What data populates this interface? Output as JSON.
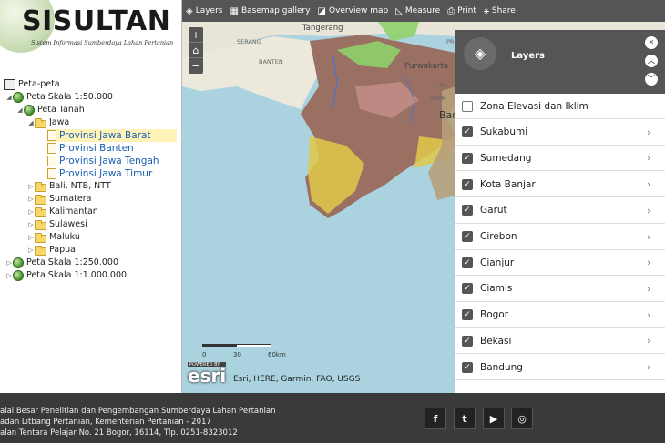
{
  "app": {
    "title": "SISULTAN",
    "subtitle": "Sistem Informasi Sumberdaya Lahan Pertanian"
  },
  "tree": {
    "root": "Peta-peta",
    "items": [
      {
        "label": "Peta Skala 1:50.000",
        "icon": "globe-icon",
        "toggle": "◢"
      },
      {
        "label": "Peta Tanah",
        "icon": "globe-icon",
        "toggle": "◢"
      },
      {
        "label": "Jawa",
        "icon": "folder-icon",
        "toggle": "◢"
      },
      {
        "label": "Provinsi Jawa Barat",
        "icon": "document-icon",
        "selected": true
      },
      {
        "label": "Provinsi Banten",
        "icon": "document-icon"
      },
      {
        "label": "Provinsi Jawa Tengah",
        "icon": "document-icon"
      },
      {
        "label": "Provinsi Jawa Timur",
        "icon": "document-icon"
      },
      {
        "label": "Bali, NTB, NTT",
        "icon": "folder-icon",
        "toggle": "▷"
      },
      {
        "label": "Sumatera",
        "icon": "folder-icon",
        "toggle": "▷"
      },
      {
        "label": "Kalimantan",
        "icon": "folder-icon",
        "toggle": "▷"
      },
      {
        "label": "Sulawesi",
        "icon": "folder-icon",
        "toggle": "▷"
      },
      {
        "label": "Maluku",
        "icon": "folder-icon",
        "toggle": "▷"
      },
      {
        "label": "Papua",
        "icon": "folder-icon",
        "toggle": "▷"
      },
      {
        "label": "Peta Skala 1:250.000",
        "icon": "globe-icon",
        "toggle": "▷"
      },
      {
        "label": "Peta Skala 1:1.000.000",
        "icon": "globe-icon",
        "toggle": "▷"
      }
    ]
  },
  "toolbar": {
    "layers": "Layers",
    "basemap": "Basemap gallery",
    "overview": "Overview map",
    "measure": "Measure",
    "print": "Print",
    "share": "Share"
  },
  "zoom": {
    "in": "+",
    "home": "⌂",
    "out": "−"
  },
  "map": {
    "labels": {
      "tangerang": "Tangerang",
      "serang": "SERANG",
      "banten": "BANTEN",
      "purwakarta": "Purwakarta",
      "pr": "PR",
      "jawa": "JAWA",
      "bar": "Bar",
      "ba": "BA"
    },
    "scale": {
      "s0": "0",
      "s30": "30",
      "s60": "60km"
    },
    "esri_powered": "POWERED BY",
    "esri": "esri",
    "attribution": "Esri, HERE, Garmin, FAO, USGS"
  },
  "layers": {
    "title": "Layers",
    "items": [
      {
        "name": "Zona Elevasi dan Iklim",
        "checked": false,
        "chevron": false
      },
      {
        "name": "Sukabumi",
        "checked": true,
        "chevron": true
      },
      {
        "name": "Sumedang",
        "checked": true,
        "chevron": true
      },
      {
        "name": "Kota Banjar",
        "checked": true,
        "chevron": true
      },
      {
        "name": "Garut",
        "checked": true,
        "chevron": true
      },
      {
        "name": "Cirebon",
        "checked": true,
        "chevron": true
      },
      {
        "name": "Cianjur",
        "checked": true,
        "chevron": true
      },
      {
        "name": "Ciamis",
        "checked": true,
        "chevron": true
      },
      {
        "name": "Bogor",
        "checked": true,
        "chevron": true
      },
      {
        "name": "Bekasi",
        "checked": true,
        "chevron": true
      },
      {
        "name": "Bandung",
        "checked": true,
        "chevron": true
      }
    ]
  },
  "footer": {
    "line1": "alai Besar Penelitian dan Pengembangan Sumberdaya Lahan Pertanian",
    "line2": "adan Litbang Pertanian, Kementerian Pertanian - 2017",
    "line3": "alan Tentara Pelajar No. 21 Bogor, 16114, Tlp. 0251-8323012",
    "social": [
      "f",
      "t",
      "▶",
      "◎"
    ]
  },
  "colors": {
    "toolbar": "#555555",
    "ocean": "#aad3df",
    "land": "#e8e4d8",
    "soil_brown": "#9a7062",
    "soil_yellow": "#e0c84a",
    "soil_green": "#8fd06a",
    "link": "#1a5fb4",
    "footer": "#3a3a3a"
  }
}
